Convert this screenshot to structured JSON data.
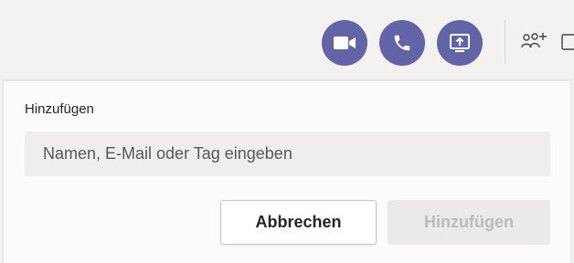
{
  "header": {
    "video_call_icon": "video-camera-icon",
    "audio_call_icon": "phone-icon",
    "share_screen_icon": "share-screen-icon",
    "add_people_icon": "add-people-icon",
    "accent_color": "#6264a7"
  },
  "panel": {
    "label": "Hinzufügen",
    "search": {
      "placeholder": "Namen, E-Mail oder Tag eingeben",
      "value": ""
    },
    "cancel_label": "Abbrechen",
    "add_label": "Hinzufügen"
  }
}
